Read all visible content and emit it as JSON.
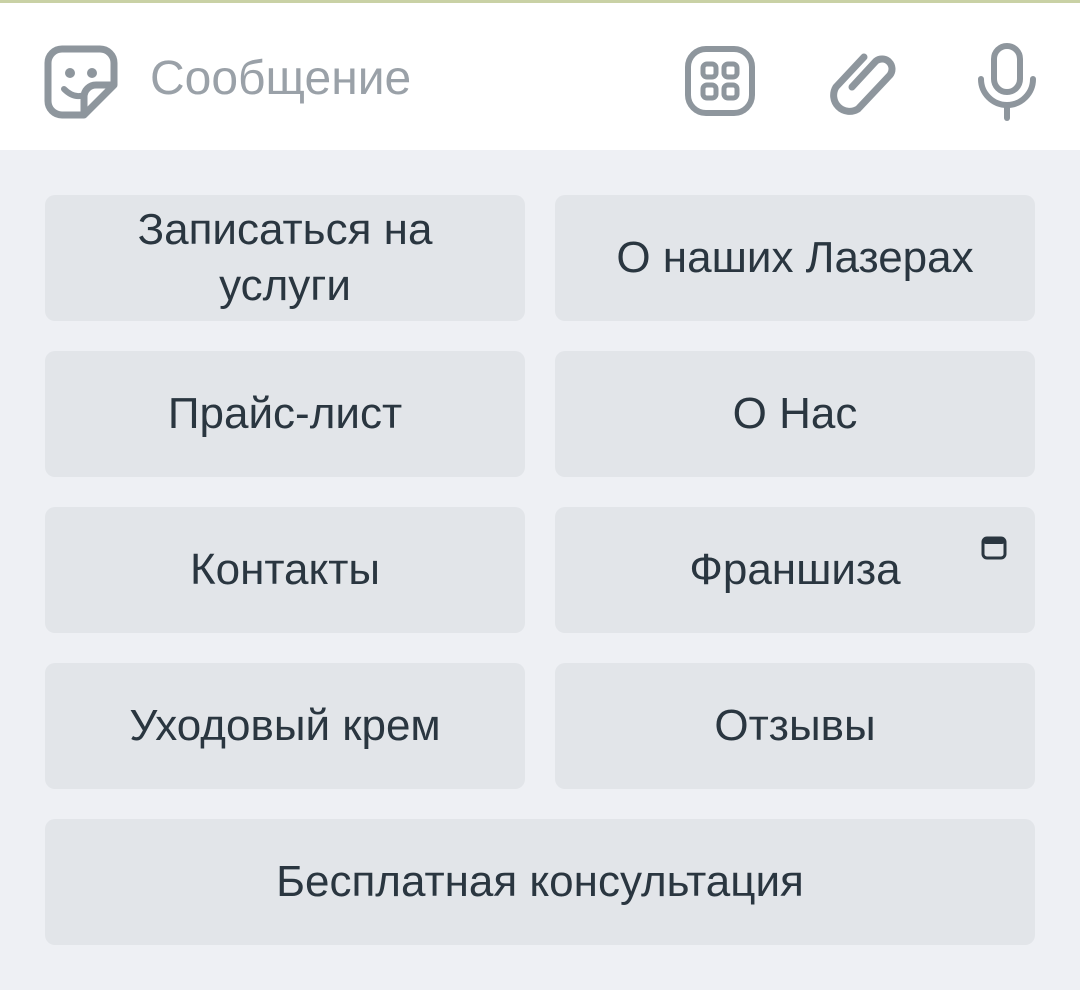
{
  "input_bar": {
    "placeholder": "Сообщение",
    "icons": [
      "sticker-icon",
      "bot-keyboard-icon",
      "paperclip-icon",
      "microphone-icon"
    ]
  },
  "keyboard": {
    "buttons": [
      {
        "label": "Записаться на услуги"
      },
      {
        "label": "О наших Лазерах"
      },
      {
        "label": "Прайс-лист"
      },
      {
        "label": "О Нас"
      },
      {
        "label": "Контакты"
      },
      {
        "label": "Франшиза",
        "icon": "web-app-icon"
      },
      {
        "label": "Уходовый крем"
      },
      {
        "label": "Отзывы"
      },
      {
        "label": "Бесплатная консультация"
      }
    ]
  },
  "colors": {
    "panel_bg": "#eef0f4",
    "button_bg": "#e2e5e9",
    "button_text": "#2a3640",
    "icon_gray": "#8e969d",
    "placeholder": "#9aa1a8"
  }
}
